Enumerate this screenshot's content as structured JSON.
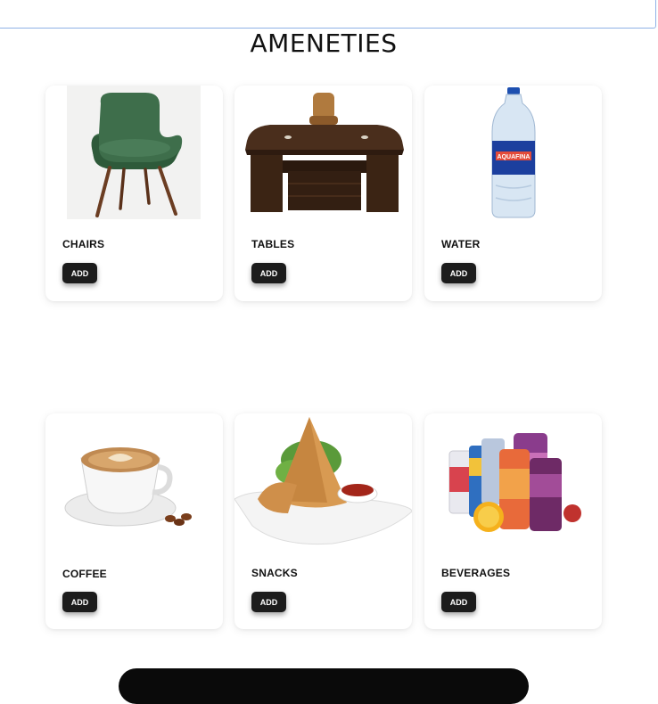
{
  "header": {
    "title": "AMENETIES"
  },
  "search": {
    "placeholder": ""
  },
  "amenities": [
    {
      "label": "CHAIRS",
      "button": "ADD",
      "image": "green-armchair"
    },
    {
      "label": "TABLES",
      "button": "ADD",
      "image": "office-desk-with-chair"
    },
    {
      "label": "WATER",
      "button": "ADD",
      "image": "water-bottle"
    },
    {
      "label": "COFFEE",
      "button": "ADD",
      "image": "coffee-cup"
    },
    {
      "label": "SNACKS",
      "button": "ADD",
      "image": "samosa-plate"
    },
    {
      "label": "BEVERAGES",
      "button": "ADD",
      "image": "soda-cans"
    }
  ]
}
